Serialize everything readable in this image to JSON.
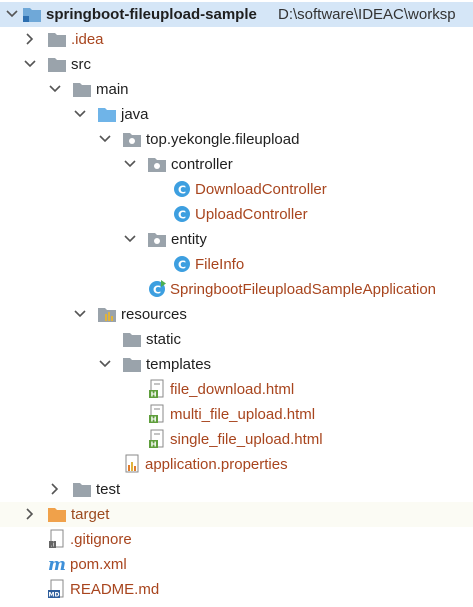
{
  "project": {
    "name": "springboot-fileupload-sample",
    "path": "D:\\software\\IDEAC\\worksp"
  },
  "nodes": {
    "idea": ".idea",
    "src": "src",
    "main": "main",
    "java": "java",
    "package": "top.yekongle.fileupload",
    "controller": "controller",
    "download_controller": "DownloadController",
    "upload_controller": "UploadController",
    "entity": "entity",
    "file_info": "FileInfo",
    "application": "SpringbootFileuploadSampleApplication",
    "resources": "resources",
    "static": "static",
    "templates": "templates",
    "file_download": "file_download.html",
    "multi_file_upload": "multi_file_upload.html",
    "single_file_upload": "single_file_upload.html",
    "app_properties": "application.properties",
    "test": "test",
    "target": "target",
    "gitignore": ".gitignore",
    "pom": "pom.xml",
    "readme": "README.md"
  },
  "colors": {
    "selection": "#d5e6f7",
    "folder_gray": "#9aa3ab",
    "folder_blue": "#6fb4e8",
    "folder_orange": "#f0a14a",
    "class_icon": "#3d9fe0",
    "html_badge": "#5f9e3c",
    "modified_text": "#a8451e"
  },
  "icons": {
    "module": "module-folder-icon",
    "folder": "folder-icon",
    "source_folder": "source-root-icon",
    "package": "package-icon",
    "class": "class-icon",
    "spring_class": "spring-boot-class-icon",
    "resources": "resources-root-icon",
    "html": "html-file-icon",
    "properties": "properties-file-icon",
    "excluded": "excluded-folder-icon",
    "gitignore": "gitignore-file-icon",
    "maven": "maven-icon",
    "markdown": "markdown-icon"
  }
}
